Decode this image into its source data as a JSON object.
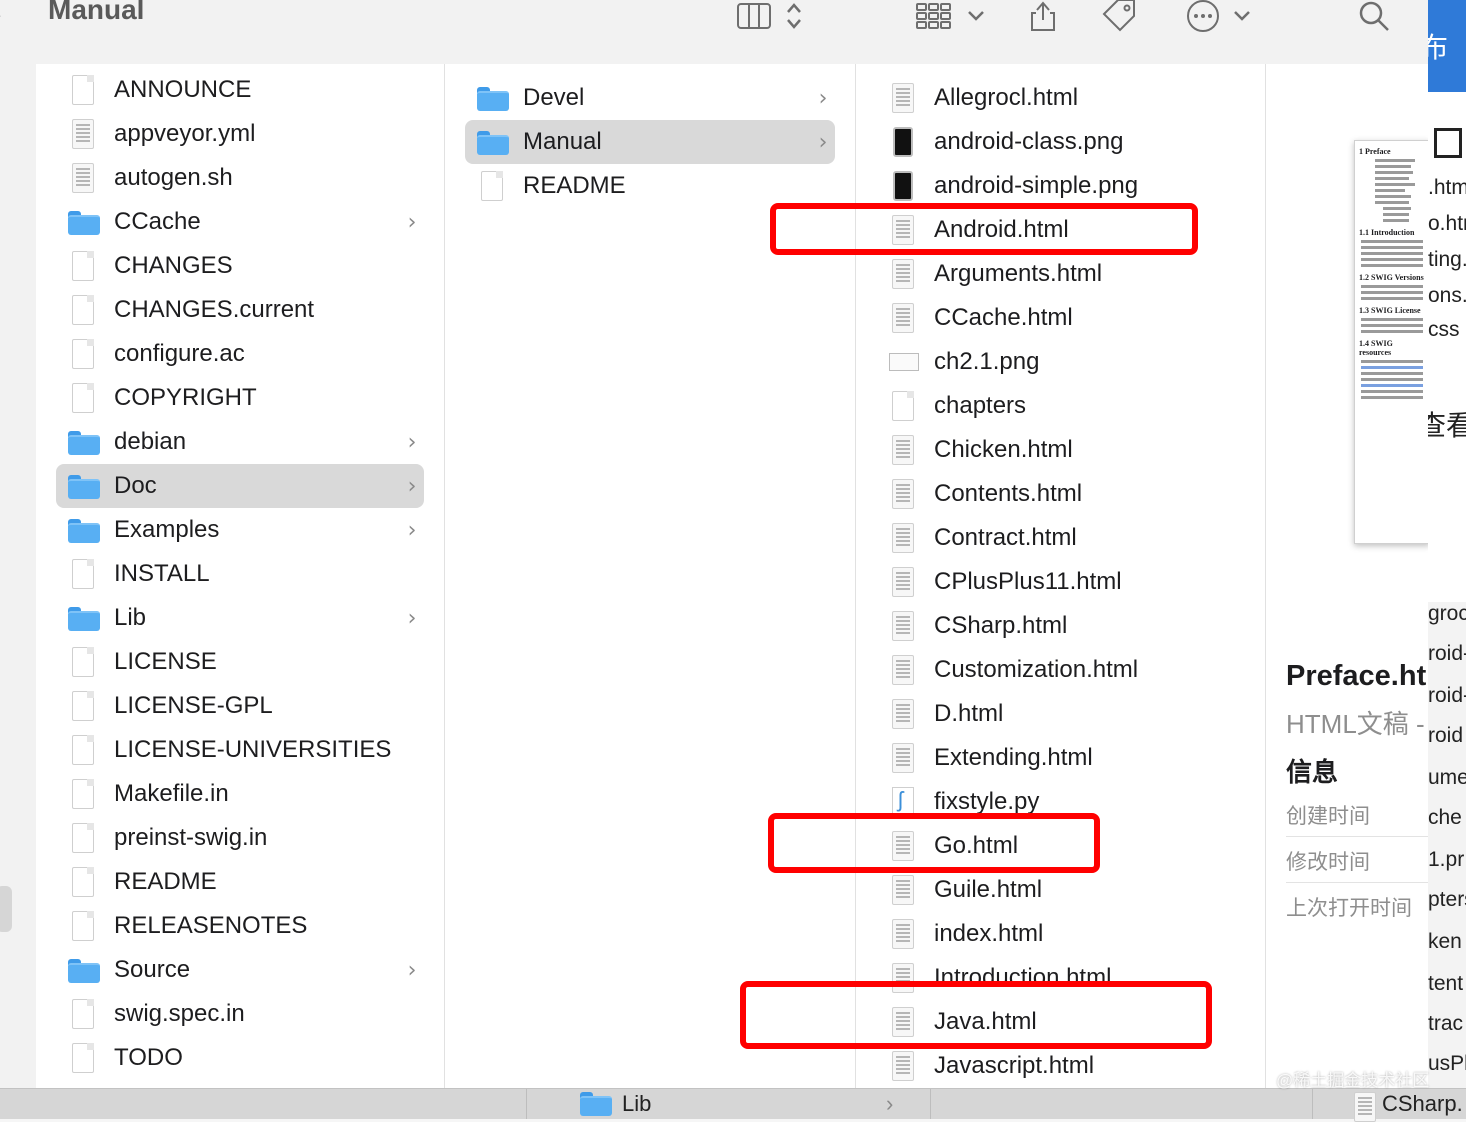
{
  "toolbar": {
    "title": "Manual",
    "back": "›"
  },
  "column1": [
    {
      "name": "ANNOUNCE",
      "icon": "document-icon",
      "kind": "doc"
    },
    {
      "name": "appveyor.yml",
      "icon": "text-file-icon",
      "kind": "code"
    },
    {
      "name": "autogen.sh",
      "icon": "text-file-icon",
      "kind": "code"
    },
    {
      "name": "CCache",
      "icon": "folder-icon",
      "kind": "folder",
      "chevron": true
    },
    {
      "name": "CHANGES",
      "icon": "document-icon",
      "kind": "doc"
    },
    {
      "name": "CHANGES.current",
      "icon": "document-icon",
      "kind": "doc"
    },
    {
      "name": "configure.ac",
      "icon": "document-icon",
      "kind": "doc"
    },
    {
      "name": "COPYRIGHT",
      "icon": "document-icon",
      "kind": "doc"
    },
    {
      "name": "debian",
      "icon": "folder-icon",
      "kind": "folder",
      "chevron": true
    },
    {
      "name": "Doc",
      "icon": "folder-icon",
      "kind": "folder",
      "chevron": true,
      "selected": true
    },
    {
      "name": "Examples",
      "icon": "folder-icon",
      "kind": "folder",
      "chevron": true
    },
    {
      "name": "INSTALL",
      "icon": "document-icon",
      "kind": "doc"
    },
    {
      "name": "Lib",
      "icon": "folder-icon",
      "kind": "folder",
      "chevron": true
    },
    {
      "name": "LICENSE",
      "icon": "document-icon",
      "kind": "doc"
    },
    {
      "name": "LICENSE-GPL",
      "icon": "document-icon",
      "kind": "doc"
    },
    {
      "name": "LICENSE-UNIVERSITIES",
      "icon": "document-icon",
      "kind": "doc"
    },
    {
      "name": "Makefile.in",
      "icon": "document-icon",
      "kind": "doc"
    },
    {
      "name": "preinst-swig.in",
      "icon": "document-icon",
      "kind": "doc"
    },
    {
      "name": "README",
      "icon": "document-icon",
      "kind": "doc"
    },
    {
      "name": "RELEASENOTES",
      "icon": "document-icon",
      "kind": "doc"
    },
    {
      "name": "Source",
      "icon": "folder-icon",
      "kind": "folder",
      "chevron": true
    },
    {
      "name": "swig.spec.in",
      "icon": "document-icon",
      "kind": "doc"
    },
    {
      "name": "TODO",
      "icon": "document-icon",
      "kind": "doc"
    }
  ],
  "column2": [
    {
      "name": "Devel",
      "icon": "folder-icon",
      "kind": "folder",
      "chevron": true
    },
    {
      "name": "Manual",
      "icon": "folder-icon",
      "kind": "folder",
      "chevron": true,
      "selected": true
    },
    {
      "name": "README",
      "icon": "document-icon",
      "kind": "doc"
    }
  ],
  "column3": [
    {
      "name": "Allegrocl.html",
      "icon": "html-file-icon",
      "kind": "code"
    },
    {
      "name": "android-class.png",
      "icon": "image-file-icon",
      "kind": "png"
    },
    {
      "name": "android-simple.png",
      "icon": "image-file-icon",
      "kind": "png"
    },
    {
      "name": "Android.html",
      "icon": "html-file-icon",
      "kind": "code",
      "highlight": true
    },
    {
      "name": "Arguments.html",
      "icon": "html-file-icon",
      "kind": "code"
    },
    {
      "name": "CCache.html",
      "icon": "html-file-icon",
      "kind": "code"
    },
    {
      "name": "ch2.1.png",
      "icon": "image-file-icon",
      "kind": "img"
    },
    {
      "name": "chapters",
      "icon": "document-icon",
      "kind": "doc"
    },
    {
      "name": "Chicken.html",
      "icon": "html-file-icon",
      "kind": "code"
    },
    {
      "name": "Contents.html",
      "icon": "html-file-icon",
      "kind": "code"
    },
    {
      "name": "Contract.html",
      "icon": "html-file-icon",
      "kind": "code"
    },
    {
      "name": "CPlusPlus11.html",
      "icon": "html-file-icon",
      "kind": "code"
    },
    {
      "name": "CSharp.html",
      "icon": "html-file-icon",
      "kind": "code"
    },
    {
      "name": "Customization.html",
      "icon": "html-file-icon",
      "kind": "code"
    },
    {
      "name": "D.html",
      "icon": "html-file-icon",
      "kind": "code"
    },
    {
      "name": "Extending.html",
      "icon": "html-file-icon",
      "kind": "code"
    },
    {
      "name": "fixstyle.py",
      "icon": "python-file-icon",
      "kind": "py"
    },
    {
      "name": "Go.html",
      "icon": "html-file-icon",
      "kind": "code",
      "highlight": true
    },
    {
      "name": "Guile.html",
      "icon": "html-file-icon",
      "kind": "code"
    },
    {
      "name": "index.html",
      "icon": "html-file-icon",
      "kind": "code"
    },
    {
      "name": "Introduction.html",
      "icon": "html-file-icon",
      "kind": "code"
    },
    {
      "name": "Java.html",
      "icon": "html-file-icon",
      "kind": "code",
      "highlight": true
    },
    {
      "name": "Javascript.html",
      "icon": "html-file-icon",
      "kind": "code"
    }
  ],
  "preview": {
    "thumb_headings": [
      "1 Preface",
      "1.1 Introduction",
      "1.2 SWIG Versions",
      "1.3 SWIG License",
      "1.4 SWIG resources"
    ],
    "title": "Preface.ht",
    "kind": "HTML文稿 -",
    "info_heading": "信息",
    "created_label": "创建时间",
    "modified_label": "修改时间",
    "last_opened_label": "上次打开时间"
  },
  "right_panel": {
    "top_glyph": "布",
    "mid_glyph": "查看",
    "items": [
      ".htm",
      "o.htr",
      "ting.",
      "ons.",
      "css",
      "groc",
      "roid-",
      "roid-",
      "roid",
      "ume",
      "che",
      "1.pr",
      "pters",
      "ken",
      "tent",
      "trac",
      "usPl"
    ]
  },
  "bottom_bar": {
    "folder": "Lib",
    "chevron": "›",
    "file": "CSharp."
  },
  "watermark": "@稀土掘金技术社区",
  "colors": {
    "highlight": "#ff0000",
    "selection": "#d9d9d9",
    "folder": "#58aff3",
    "accent": "#2f7ad8"
  }
}
